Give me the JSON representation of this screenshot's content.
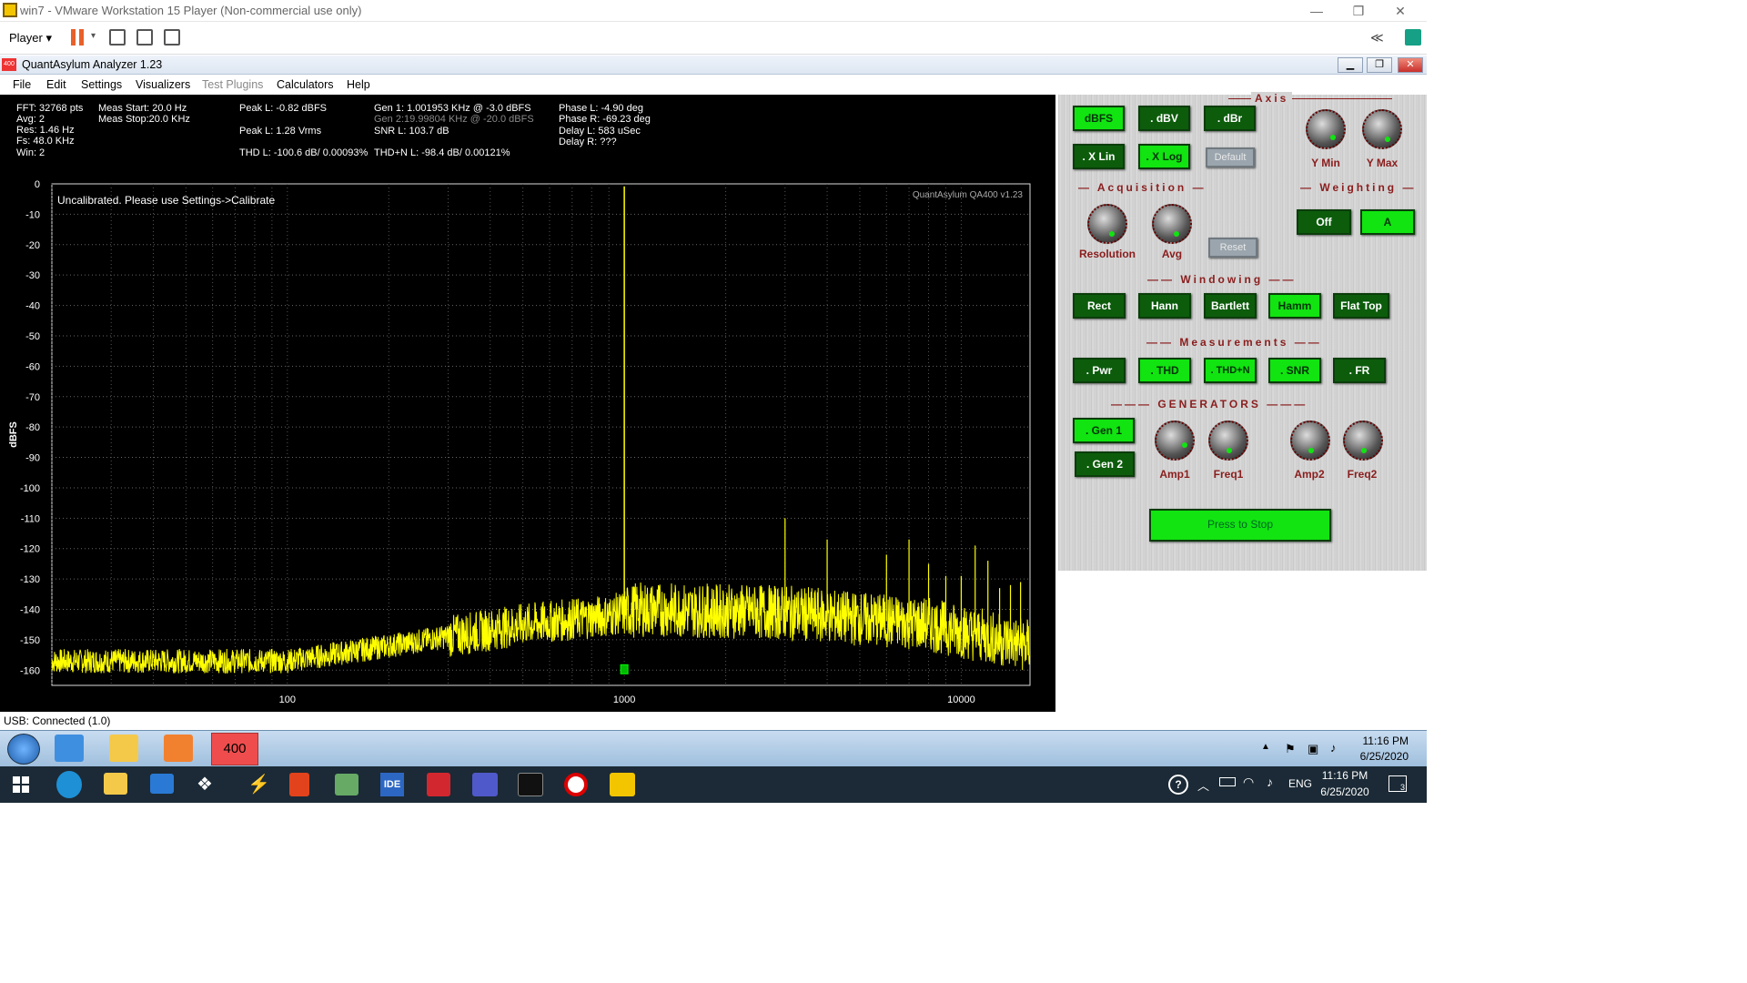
{
  "vm": {
    "title": "win7 - VMware Workstation 15 Player (Non-commercial use only)",
    "player_menu": "Player",
    "chevron": "≪"
  },
  "app": {
    "title": "QuantAsylum Analyzer 1.23",
    "icon_text": "400",
    "menu": [
      "File",
      "Edit",
      "Settings",
      "Visualizers",
      "Test Plugins",
      "Calculators",
      "Help"
    ]
  },
  "stats": {
    "fft": "FFT: 32768 pts",
    "avg": "Avg: 2",
    "res": "Res: 1.46 Hz",
    "fs": "Fs: 48.0 KHz",
    "win": "Win: 2",
    "meas_start": "Meas Start: 20.0 Hz",
    "meas_stop": "Meas Stop:20.0 KHz",
    "peak_l_dbfs": "Peak L: -0.82 dBFS",
    "peak_l_vrms": "Peak L: 1.28 Vrms",
    "thd_l": "THD L: -100.6 dB/ 0.00093%",
    "gen1": "Gen 1: 1.001953 KHz @ -3.0  dBFS",
    "gen2": "Gen 2:19.99804 KHz @ -20.0  dBFS",
    "snr_l": "SNR L: 103.7 dB",
    "thdn_l": "THD+N L: -98.4 dB/ 0.00121%",
    "phase_l": "Phase L: -4.90 deg",
    "phase_r": "Phase R: -69.23 deg",
    "delay_l": "Delay L: 583 uSec",
    "delay_r": "Delay R: ???"
  },
  "chart_data": {
    "type": "line",
    "title": "",
    "xlabel": "",
    "ylabel": "dBFS",
    "x_scale": "log",
    "xlim": [
      20,
      16000
    ],
    "ylim": [
      -165,
      0
    ],
    "y_ticks": [
      0,
      -10,
      -20,
      -30,
      -40,
      -50,
      -60,
      -70,
      -80,
      -90,
      -100,
      -110,
      -120,
      -130,
      -140,
      -150,
      -160
    ],
    "x_ticks": [
      100,
      1000,
      10000
    ],
    "grid": true,
    "annotation_left": "Uncalibrated. Please use Settings->Calibrate",
    "annotation_right": "QuantAsylum QA400 v1.23",
    "series": [
      {
        "color": "#ffff00",
        "fundamental": {
          "x": 1000,
          "y": -0.82
        },
        "harmonics": [
          {
            "x": 3000,
            "y": -110
          },
          {
            "x": 4000,
            "y": -117
          },
          {
            "x": 6000,
            "y": -122
          },
          {
            "x": 7000,
            "y": -117
          },
          {
            "x": 8000,
            "y": -125
          },
          {
            "x": 9000,
            "y": -129
          },
          {
            "x": 10000,
            "y": -129
          },
          {
            "x": 11000,
            "y": -119
          },
          {
            "x": 12000,
            "y": -124
          },
          {
            "x": 13000,
            "y": -133
          },
          {
            "x": 14000,
            "y": -132
          },
          {
            "x": 15000,
            "y": -131
          }
        ],
        "noise_floor": [
          {
            "x": 20,
            "y": -157
          },
          {
            "x": 100,
            "y": -157
          },
          {
            "x": 200,
            "y": -152
          },
          {
            "x": 500,
            "y": -145
          },
          {
            "x": 900,
            "y": -142
          },
          {
            "x": 1100,
            "y": -140
          },
          {
            "x": 3000,
            "y": -141
          },
          {
            "x": 8000,
            "y": -145
          },
          {
            "x": 16000,
            "y": -152
          }
        ]
      }
    ],
    "marker": {
      "x": 1000,
      "y": -160
    }
  },
  "panel": {
    "sections": {
      "axis": "Axis",
      "acquisition": "Acquisition",
      "weighting": "Weighting",
      "windowing": "Windowing",
      "measurements": "Measurements",
      "generators": "GENERATORS"
    },
    "axis_buttons": {
      "dbfs": "dBFS",
      "dbv": ". dBV",
      "dbr": ". dBr",
      "xlin": ". X Lin",
      "xlog": ". X Log",
      "default": "Default"
    },
    "knobs": {
      "ymin": "Y Min",
      "ymax": "Y Max",
      "resolution": "Resolution",
      "avg": "Avg",
      "amp1": "Amp1",
      "freq1": "Freq1",
      "amp2": "Amp2",
      "freq2": "Freq2"
    },
    "reset": "Reset",
    "weighting": {
      "off": "Off",
      "a": "A"
    },
    "windowing": [
      "Rect",
      "Hann",
      "Bartlett",
      "Hamm",
      "Flat Top"
    ],
    "measurements": [
      ". Pwr",
      ". THD",
      ". THD+N",
      ". SNR",
      ". FR"
    ],
    "gen1": ". Gen 1",
    "gen2": ". Gen 2",
    "stop": "Press to Stop"
  },
  "status": {
    "usb": "USB: Connected  (1.0)"
  },
  "win7_tray": {
    "time": "11:16 PM",
    "date": "6/25/2020",
    "app_label": "400"
  },
  "win10_tray": {
    "lang": "ENG",
    "time": "11:16 PM",
    "date": "6/25/2020",
    "notif": "3"
  }
}
